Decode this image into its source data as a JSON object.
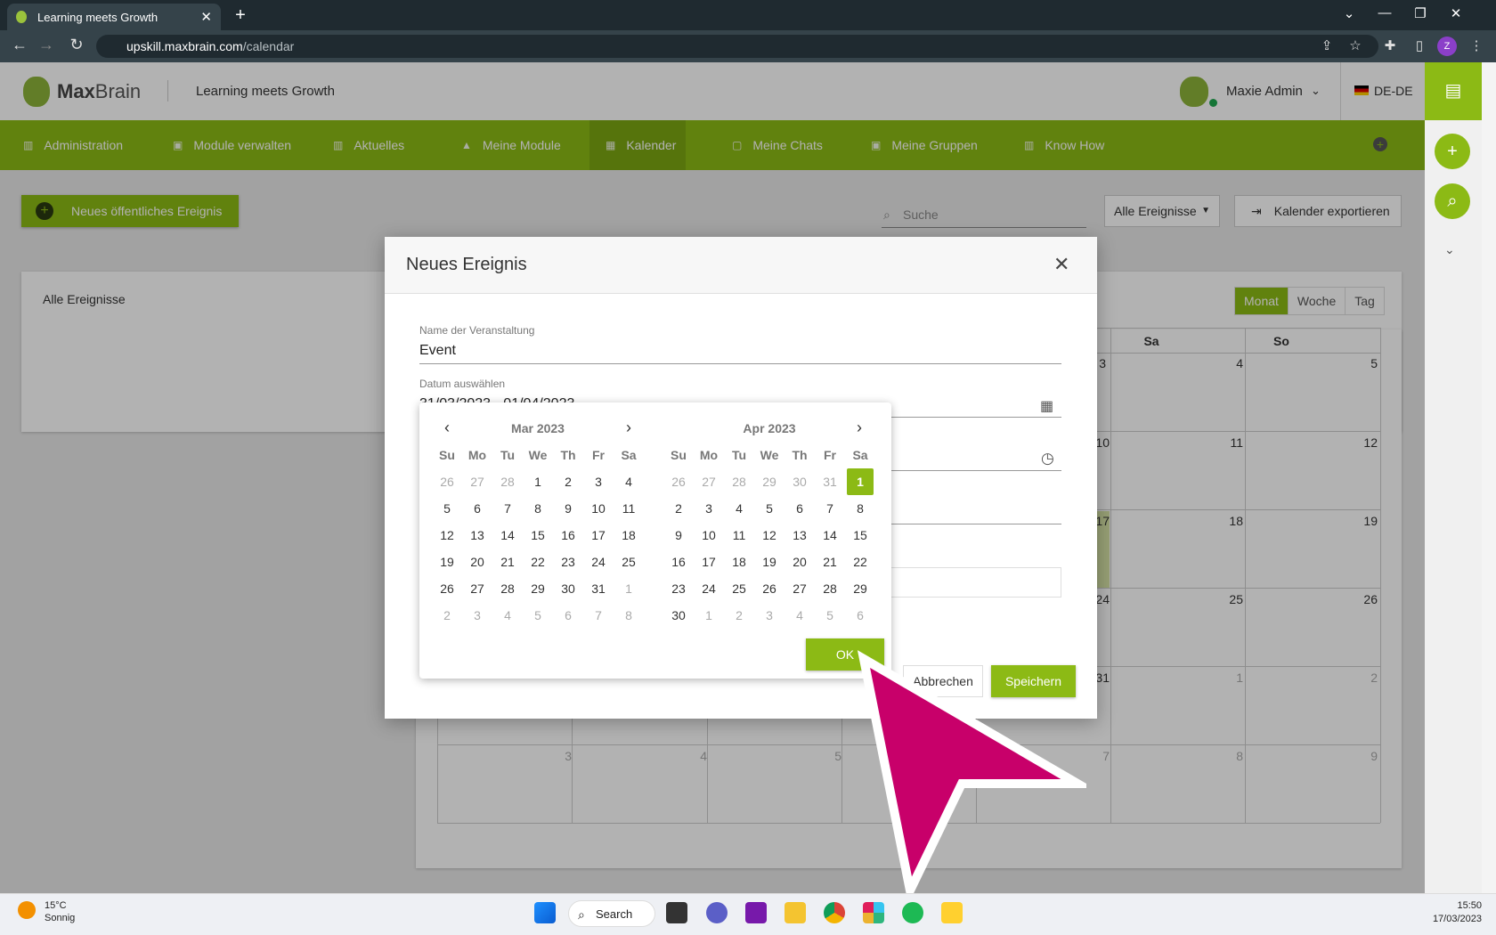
{
  "browser": {
    "tab_title": "Learning meets Growth",
    "url_host": "upskill.maxbrain.com",
    "url_path": "/calendar",
    "profile_initial": "Z"
  },
  "header": {
    "logo_max": "Max",
    "logo_brain": "Brain",
    "slogan": "Learning meets Growth",
    "username": "Maxie Admin",
    "language": "DE-DE"
  },
  "nav": [
    {
      "label": "Administration"
    },
    {
      "label": "Module verwalten"
    },
    {
      "label": "Aktuelles"
    },
    {
      "label": "Meine Module"
    },
    {
      "label": "Kalender"
    },
    {
      "label": "Meine Chats"
    },
    {
      "label": "Meine Gruppen"
    },
    {
      "label": "Know How"
    }
  ],
  "page": {
    "new_public_event": "Neues öffentliches Ereignis",
    "search_placeholder": "Suche",
    "filter_value": "Alle Ereignisse",
    "export_label": "Kalender exportieren",
    "card_title": "Alle Ereignisse",
    "views": [
      "Monat",
      "Woche",
      "Tag"
    ],
    "col_headers": [
      "Sa",
      "So"
    ],
    "cell_numbers": [
      "3",
      "4",
      "5",
      "10",
      "11",
      "12",
      "17",
      "18",
      "19",
      "24",
      "25",
      "26",
      "31",
      "1",
      "2",
      "7",
      "8",
      "9",
      "3",
      "4",
      "5"
    ]
  },
  "dialog": {
    "title": "Neues Ereignis",
    "name_label": "Name der Veranstaltung",
    "name_value": "Event",
    "date_label": "Datum auswählen",
    "date_value": "31/03/2023 - 01/04/2023",
    "cancel": "Abbrechen",
    "save": "Speichern"
  },
  "picker": {
    "left_title": "Mar 2023",
    "right_title": "Apr 2023",
    "dow": [
      "Su",
      "Mo",
      "Tu",
      "We",
      "Th",
      "Fr",
      "Sa"
    ],
    "left_weeks": [
      [
        "26",
        "27",
        "28",
        "1",
        "2",
        "3",
        "4"
      ],
      [
        "5",
        "6",
        "7",
        "8",
        "9",
        "10",
        "11"
      ],
      [
        "12",
        "13",
        "14",
        "15",
        "16",
        "17",
        "18"
      ],
      [
        "19",
        "20",
        "21",
        "22",
        "23",
        "24",
        "25"
      ],
      [
        "26",
        "27",
        "28",
        "29",
        "30",
        "31",
        "1"
      ],
      [
        "2",
        "3",
        "4",
        "5",
        "6",
        "7",
        "8"
      ]
    ],
    "right_weeks": [
      [
        "26",
        "27",
        "28",
        "29",
        "30",
        "31",
        "1"
      ],
      [
        "2",
        "3",
        "4",
        "5",
        "6",
        "7",
        "8"
      ],
      [
        "9",
        "10",
        "11",
        "12",
        "13",
        "14",
        "15"
      ],
      [
        "16",
        "17",
        "18",
        "19",
        "20",
        "21",
        "22"
      ],
      [
        "23",
        "24",
        "25",
        "26",
        "27",
        "28",
        "29"
      ],
      [
        "30",
        "1",
        "2",
        "3",
        "4",
        "5",
        "6"
      ]
    ],
    "ok": "OK"
  },
  "taskbar": {
    "temperature": "15°C",
    "weather": "Sonnig",
    "search": "Search",
    "time": "15:50",
    "date": "17/03/2023"
  },
  "colors": {
    "accent": "#8cba15",
    "cursor": "#c8006a"
  }
}
